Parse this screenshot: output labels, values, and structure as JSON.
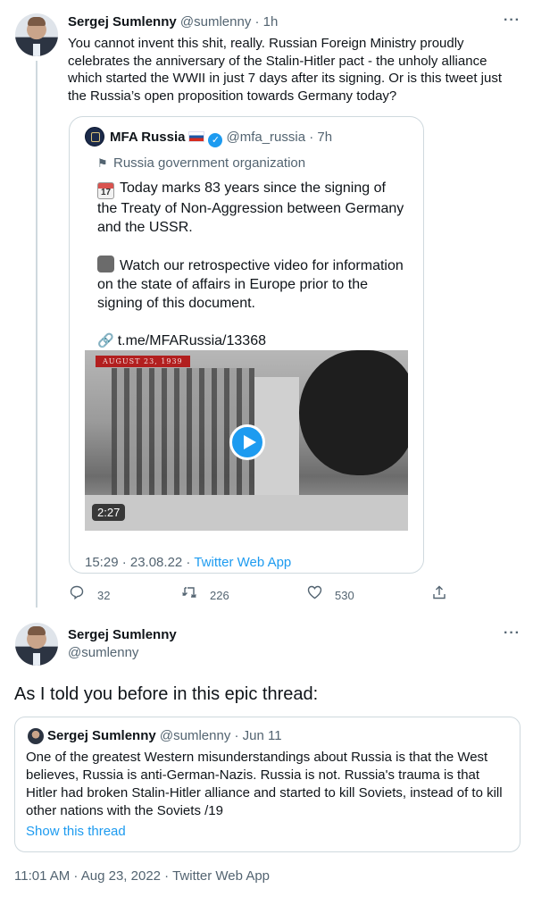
{
  "tweet1": {
    "author_name": "Sergej Sumlenny",
    "author_handle": "@sumlenny",
    "separator": "·",
    "time": "1h",
    "more": "···",
    "text": "You cannot invent this shit, really. Russian Foreign Ministry proudly celebrates the anniversary of the Stalin-Hitler pact - the unholy alliance which started the WWII in just 7 days after its signing. Or is this tweet just the Russia’s open proposition towards Germany today?",
    "quoted": {
      "author_name": "MFA Russia",
      "author_handle": "@mfa_russia",
      "separator": "·",
      "time": "7h",
      "verified_mark": "✓",
      "gov_label": "Russia government organization",
      "calendar_emoji_num": "17",
      "paragraph1": "Today marks 83 years since the signing of the Treaty of Non-Aggression between Germany and the USSR.",
      "paragraph2": "Watch our retrospective video for information on the state of affairs in Europe prior to the signing of this document.",
      "link": "t.me/MFARussia/13368",
      "video_tag": "AUGUST 23, 1939",
      "video_duration": "2:27",
      "meta_time": "15:29 · 23.08.22 · ",
      "meta_app": "Twitter Web App"
    },
    "actions": {
      "replies": "32",
      "retweets": "226",
      "likes": "530"
    }
  },
  "tweet2": {
    "author_name": "Sergej Sumlenny",
    "author_handle": "@sumlenny",
    "more": "···",
    "text": "As I told you before in this epic thread:",
    "quoted": {
      "author_name": "Sergej Sumlenny",
      "author_handle": "@sumlenny",
      "separator": "·",
      "time": "Jun 11",
      "text": "One of the greatest Western misunderstandings about Russia is that the West believes, Russia is anti-German-Nazis. Russia is not. Russia's trauma is that Hitler had broken Stalin-Hitler alliance and started to kill Soviets, instead of to kill other nations with the Soviets /19",
      "show_thread": "Show this thread"
    },
    "meta": "11:01 AM · Aug 23, 2022 · Twitter Web App"
  },
  "colors": {
    "accent": "#1d9bf0",
    "text": "#0f1419",
    "muted": "#536471",
    "border": "#cfd9de"
  }
}
